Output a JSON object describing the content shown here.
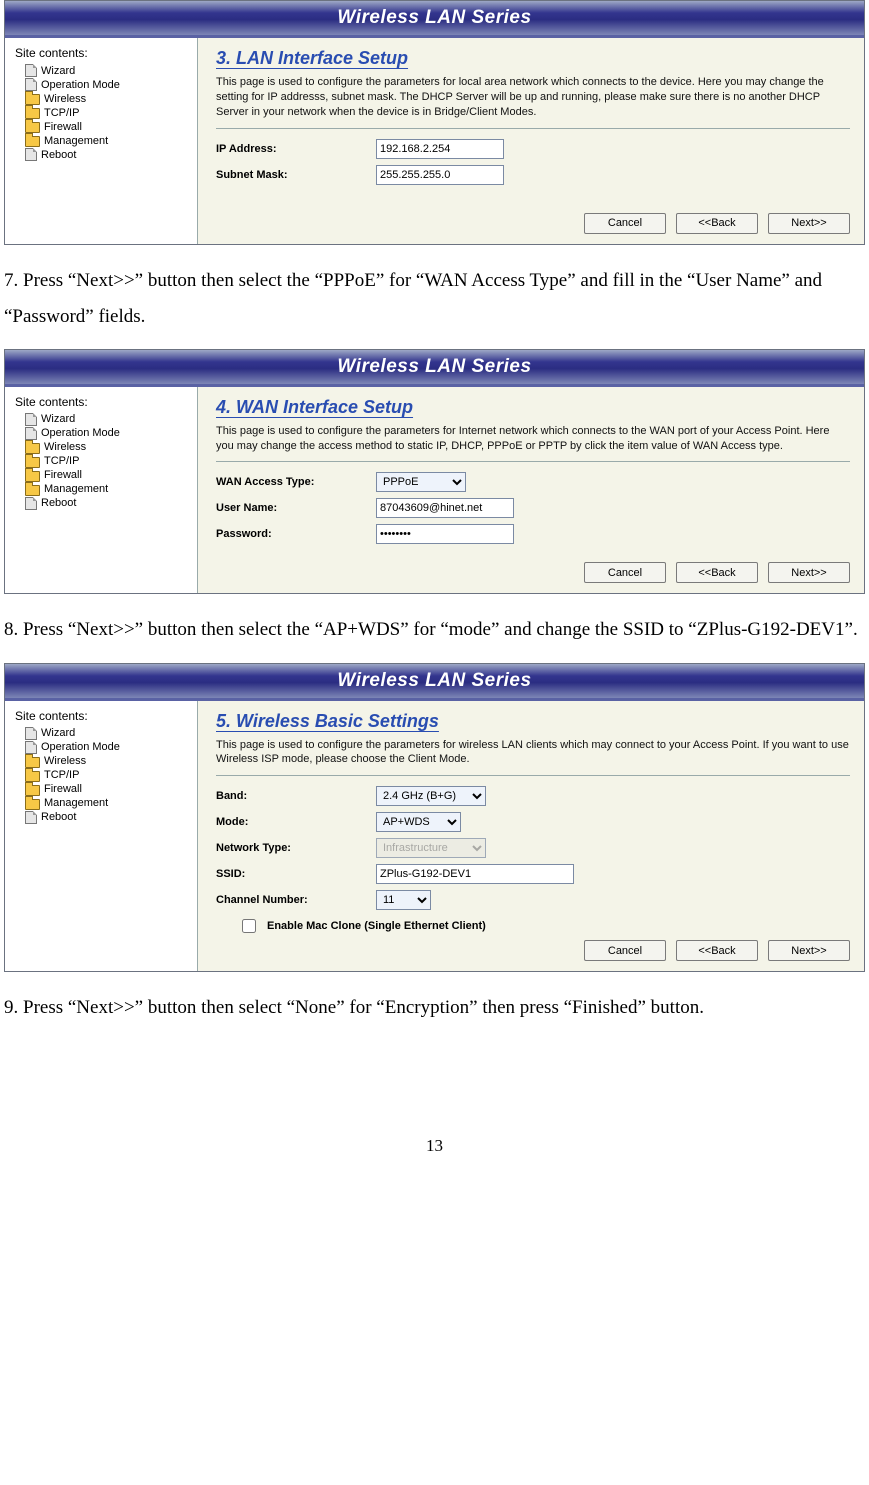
{
  "header_title": "Wireless LAN Series",
  "sidebar": {
    "title": "Site contents:",
    "items": [
      {
        "label": "Wizard",
        "type": "file"
      },
      {
        "label": "Operation Mode",
        "type": "file"
      },
      {
        "label": "Wireless",
        "type": "folder"
      },
      {
        "label": "TCP/IP",
        "type": "folder"
      },
      {
        "label": "Firewall",
        "type": "folder"
      },
      {
        "label": "Management",
        "type": "folder"
      },
      {
        "label": "Reboot",
        "type": "file"
      }
    ]
  },
  "buttons": {
    "cancel": "Cancel",
    "back": "<<Back",
    "next": "Next>>"
  },
  "panel3": {
    "heading": "3. LAN Interface Setup",
    "desc": "This page is used to configure the parameters for local area network which connects to the device. Here you may change the setting for IP addresss, subnet mask. The DHCP Server will be up and running, please make sure there is no another DHCP Server in your network when the device is in Bridge/Client Modes.",
    "ip_label": "IP Address:",
    "ip_value": "192.168.2.254",
    "mask_label": "Subnet Mask:",
    "mask_value": "255.255.255.0"
  },
  "instr7": "7. Press “Next>>” button then select the “PPPoE” for “WAN Access Type” and fill in the “User Name” and “Password” fields.",
  "panel4": {
    "heading": "4. WAN Interface Setup",
    "desc": "This page is used to configure the parameters for Internet network which connects to the WAN port of your Access Point. Here you may change the access method to static IP, DHCP, PPPoE or PPTP by click the item value of WAN Access type.",
    "wan_label": "WAN Access Type:",
    "wan_value": "PPPoE",
    "user_label": "User Name:",
    "user_value": "87043609@hinet.net",
    "pass_label": "Password:",
    "pass_value": "••••••••"
  },
  "instr8": "8. Press “Next>>” button then select the “AP+WDS” for “mode” and change the SSID to “ZPlus-G192-DEV1”.",
  "panel5": {
    "heading": "5. Wireless Basic Settings",
    "desc": "This page is used to configure the parameters for wireless LAN clients which may connect to your Access Point. If you want to use Wireless ISP mode, please choose the Client Mode.",
    "band_label": "Band:",
    "band_value": "2.4 GHz (B+G)",
    "mode_label": "Mode:",
    "mode_value": "AP+WDS",
    "nettype_label": "Network Type:",
    "nettype_value": "Infrastructure",
    "ssid_label": "SSID:",
    "ssid_value": "ZPlus-G192-DEV1",
    "chan_label": "Channel Number:",
    "chan_value": "11",
    "mac_label": "Enable Mac Clone (Single Ethernet Client)"
  },
  "instr9": "9. Press “Next>>” button then select “None” for “Encryption” then press “Finished” button.",
  "page_number": "13"
}
